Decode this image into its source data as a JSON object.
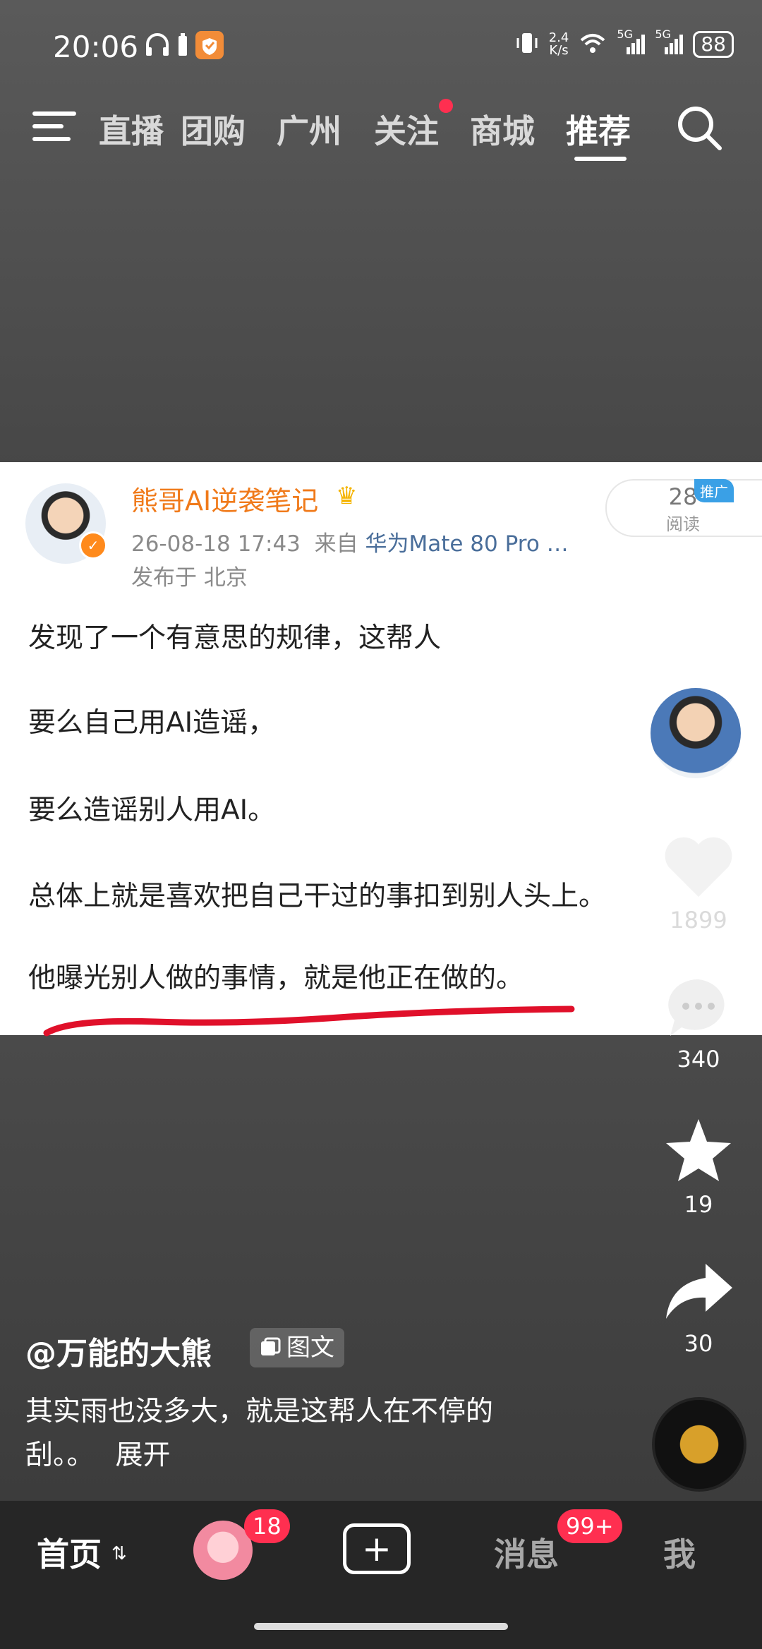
{
  "status": {
    "time": "20:06",
    "net_speed_top": "2.4",
    "net_speed_bottom": "K/s",
    "sig1": "5G",
    "sig2": "5G",
    "battery": "88"
  },
  "topnav": {
    "tabs": [
      "直播",
      "团购",
      "广州",
      "关注",
      "商城",
      "推荐"
    ],
    "active": "推荐"
  },
  "post": {
    "author": "熊哥AI逆袭笔记",
    "date": "26-08-18 17:43",
    "from_label": "来自",
    "device": "华为Mate 80 Pro …",
    "location": "发布于 北京",
    "read_count": "28",
    "read_label": "阅读",
    "ad_tag": "推广",
    "lines": [
      "发现了一个有意思的规律，这帮人",
      "要么自己用AI造谣，",
      "要么造谣别人用AI。",
      "总体上就是喜欢把自己干过的事扣到别人头上。",
      "他曝光别人做的事情，就是他正在做的。"
    ]
  },
  "rail": {
    "like_count": "1899",
    "comment_count": "340",
    "fav_count": "19",
    "share_count": "30"
  },
  "caption": {
    "user": "@万能的大熊",
    "type_tag": "图文",
    "text_line1": "其实雨也没多大，就是这帮人在不停的",
    "text_line2": "刮。。",
    "expand": "展开"
  },
  "tabbar": {
    "home": "首页",
    "friends_badge": "18",
    "messages": "消息",
    "messages_badge": "99+",
    "me": "我"
  },
  "colors": {
    "accent_red": "#ff2f50",
    "author_orange": "#f07a1a",
    "device_blue": "#4a6e9a"
  }
}
